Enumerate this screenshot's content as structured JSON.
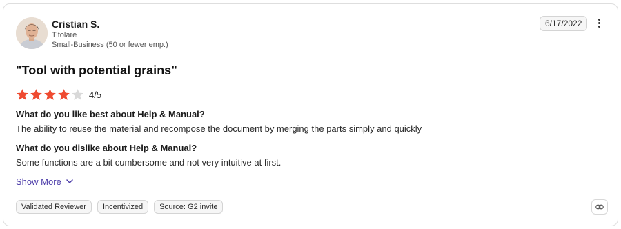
{
  "reviewer": {
    "name": "Cristian S.",
    "title": "Titolare",
    "segment": "Small-Business (50 or fewer emp.)"
  },
  "date": "6/17/2022",
  "review": {
    "title": "\"Tool with potential grains\"",
    "rating": 4,
    "rating_max": 5,
    "rating_label": "4/5",
    "star_color": "#ef4a30",
    "qa": [
      {
        "question": "What do you like best about Help & Manual?",
        "answer": "The ability to reuse the material and recompose the document by merging the parts simply and quickly"
      },
      {
        "question": "What do you dislike about Help & Manual?",
        "answer": "Some functions are a bit cumbersome and not very intuitive at first."
      }
    ],
    "show_more_label": "Show More"
  },
  "tags": [
    "Validated Reviewer",
    "Incentivized",
    "Source: G2 invite"
  ],
  "icons": {
    "menu": "more-vertical-icon",
    "expand": "chevron-down-icon",
    "link": "link-icon"
  },
  "colors": {
    "link_text": "#4a3aa8",
    "star_filled": "#ef4a30",
    "star_empty": "#d9d9d9"
  }
}
